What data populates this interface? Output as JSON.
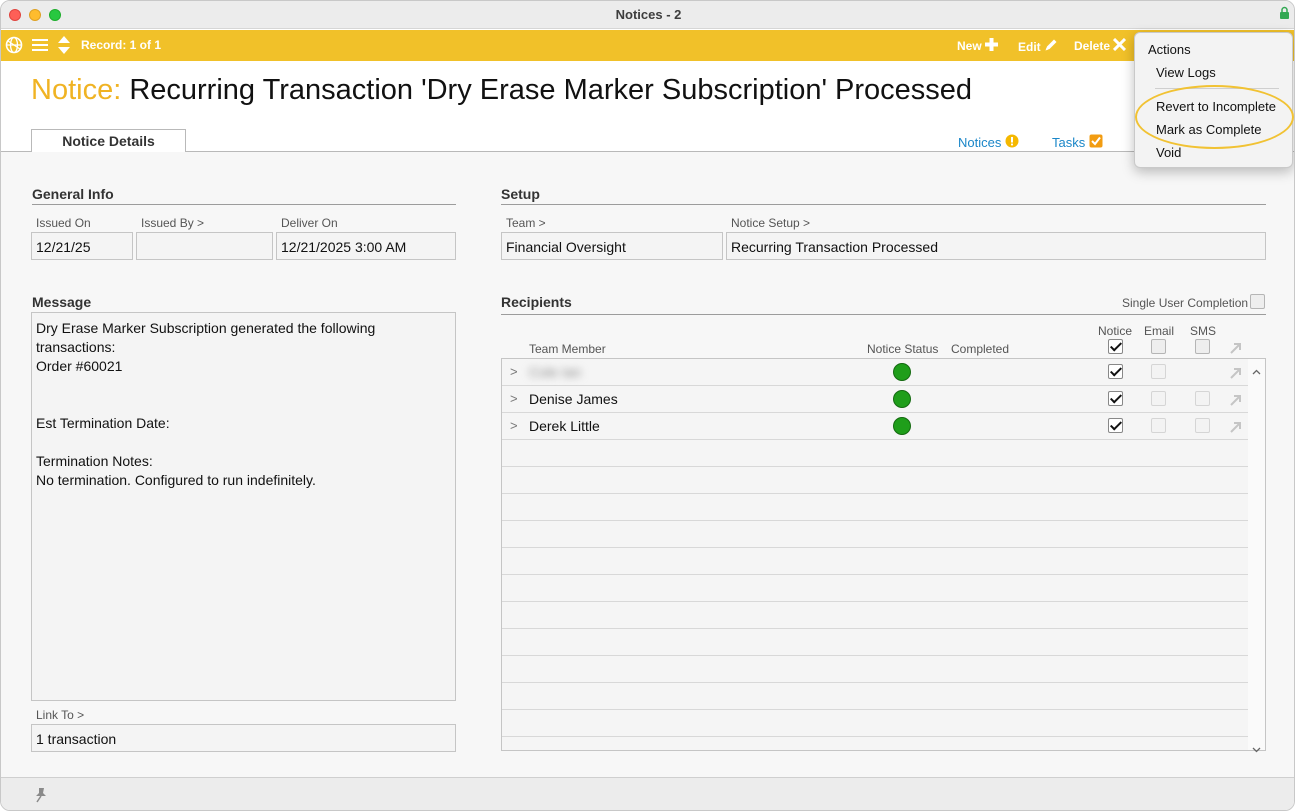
{
  "window": {
    "title": "Notices - 2"
  },
  "toolbar": {
    "record_label": "Record: 1 of 1",
    "new_label": "New",
    "edit_label": "Edit",
    "delete_label": "Delete"
  },
  "header": {
    "prefix": "Notice:",
    "title": "Recurring Transaction 'Dry Erase Marker Subscription' Processed"
  },
  "tabs": {
    "details": "Notice Details",
    "notices": "Notices",
    "tasks": "Tasks"
  },
  "general_info": {
    "heading": "General Info",
    "issued_on_label": "Issued On",
    "issued_on": "12/21/25",
    "issued_by_label": "Issued By >",
    "issued_by": "",
    "deliver_on_label": "Deliver On",
    "deliver_on": "12/21/2025 3:00 AM"
  },
  "setup": {
    "heading": "Setup",
    "team_label": "Team >",
    "team": "Financial Oversight",
    "notice_setup_label": "Notice Setup >",
    "notice_setup": "Recurring Transaction Processed"
  },
  "message": {
    "heading": "Message",
    "lines": [
      "Dry Erase Marker Subscription generated the following",
      "transactions:",
      "Order #60021",
      "",
      "",
      "Est Termination Date:",
      "",
      "Termination Notes:",
      "No termination. Configured to run indefinitely."
    ],
    "link_to_label": "Link To >",
    "link_to": "1 transaction"
  },
  "recipients": {
    "heading": "Recipients",
    "single_user_label": "Single User Completion",
    "col_team_member": "Team Member",
    "col_notice_status": "Notice Status",
    "col_completed": "Completed",
    "col_notice": "Notice",
    "col_email": "Email",
    "col_sms": "SMS",
    "rows": [
      {
        "chevron": ">",
        "name": "Cole Ian",
        "completed": ""
      },
      {
        "chevron": ">",
        "name": "Denise James",
        "completed": ""
      },
      {
        "chevron": ">",
        "name": "Derek Little",
        "completed": ""
      }
    ]
  },
  "actions_menu": {
    "title": "Actions",
    "items": [
      "View Logs",
      "Revert to Incomplete",
      "Mark as Complete",
      "Void"
    ]
  },
  "colors": {
    "toolbar": "#f1c129",
    "accent": "#f0b323",
    "status_ok": "#1f9e1a",
    "link": "#1a86c8"
  }
}
